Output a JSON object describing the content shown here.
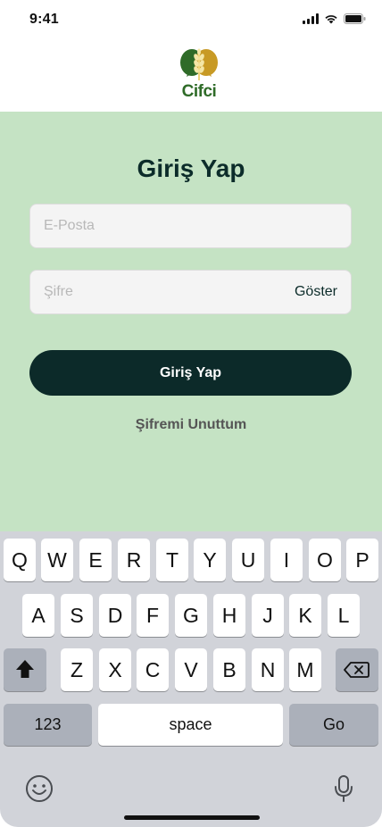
{
  "status": {
    "time": "9:41"
  },
  "logo": {
    "text": "Cifci"
  },
  "form": {
    "title": "Giriş Yap",
    "email_placeholder": "E-Posta",
    "password_placeholder": "Şifre",
    "show_label": "Göster",
    "login_label": "Giriş Yap",
    "forgot_label": "Şifremi Unuttum"
  },
  "keyboard": {
    "row1": [
      "Q",
      "W",
      "E",
      "R",
      "T",
      "Y",
      "U",
      "I",
      "O",
      "P"
    ],
    "row2": [
      "A",
      "S",
      "D",
      "F",
      "G",
      "H",
      "J",
      "K",
      "L"
    ],
    "row3": [
      "Z",
      "X",
      "C",
      "V",
      "B",
      "N",
      "M"
    ],
    "numbers_label": "123",
    "space_label": "space",
    "go_label": "Go"
  },
  "colors": {
    "form_background": "#c5e3c4",
    "primary": "#0c2a29",
    "keyboard_background": "#d1d3d9"
  }
}
